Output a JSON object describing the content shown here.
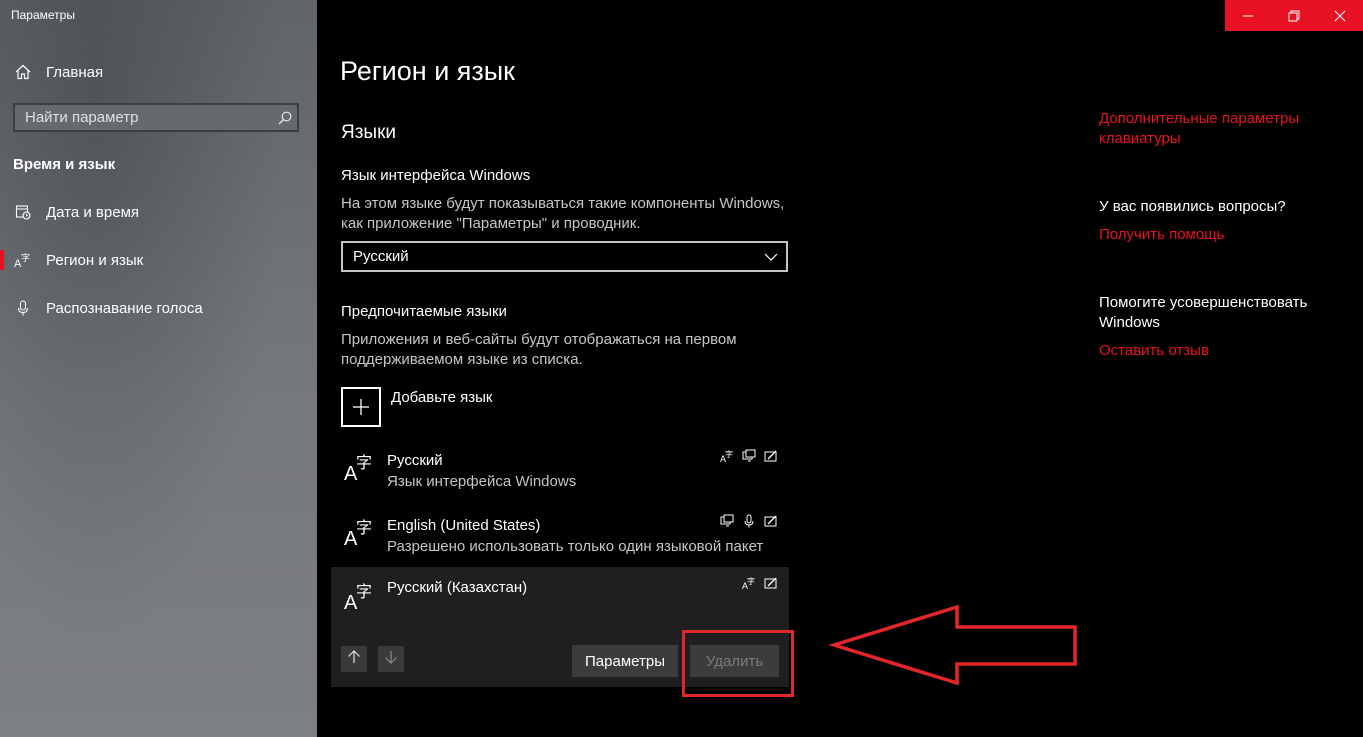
{
  "window": {
    "title": "Параметры",
    "controls": [
      "minimize-icon",
      "restore-icon",
      "close-icon"
    ],
    "accent_color": "#e81123"
  },
  "sidebar": {
    "home_label": "Главная",
    "search_placeholder": "Найти параметр",
    "section_title": "Время и язык",
    "items": [
      {
        "label": "Дата и время",
        "icon": "calendar-clock-icon",
        "active": false
      },
      {
        "label": "Регион и язык",
        "icon": "language-icon",
        "active": true
      },
      {
        "label": "Распознавание голоса",
        "icon": "microphone-icon",
        "active": false
      }
    ]
  },
  "main": {
    "page_title": "Регион и язык",
    "languages_heading": "Языки",
    "display_language": {
      "heading": "Язык интерфейса Windows",
      "description_line1": "На этом языке будут показываться такие компоненты Windows,",
      "description_line2": "как приложение \"Параметры\" и проводник.",
      "selected": "Русский"
    },
    "preferred": {
      "heading": "Предпочитаемые языки",
      "description_line1": "Приложения и веб-сайты будут отображаться на первом",
      "description_line2": "поддерживаемом языке из списка.",
      "add_label": "Добавьте язык",
      "languages": [
        {
          "name": "Русский",
          "subtitle": "Язык интерфейса Windows",
          "features": [
            "display-language-icon",
            "text-to-speech-icon",
            "handwriting-icon"
          ]
        },
        {
          "name": "English (United States)",
          "subtitle": "Разрешено использовать только один языковой пакет",
          "features": [
            "text-to-speech-icon",
            "speech-recognition-icon",
            "handwriting-icon"
          ]
        },
        {
          "name": "Русский (Казахстан)",
          "subtitle": "",
          "features": [
            "display-language-icon",
            "handwriting-icon"
          ],
          "selected": true
        }
      ],
      "options_button": "Параметры",
      "remove_button": "Удалить"
    }
  },
  "related": {
    "keyboard_link_line1": "Дополнительные параметры",
    "keyboard_link_line2": "клавиатуры",
    "questions_heading": "У вас появились вопросы?",
    "help_link": "Получить помощь",
    "improve_heading_line1": "Помогите усовершенствовать",
    "improve_heading_line2": "Windows",
    "feedback_link": "Оставить отзыв"
  }
}
